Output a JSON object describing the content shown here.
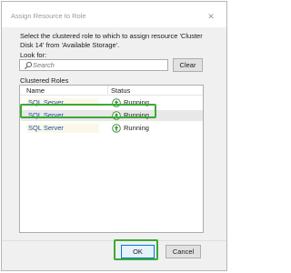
{
  "window": {
    "title": "Assign Resource to Role",
    "close_glyph": "✕"
  },
  "instruction": "Select the clustered role to which to assign resource 'Cluster Disk 14' from 'Available Storage'.",
  "look_for": {
    "label": "Look for:",
    "placeholder": "Search",
    "value": ""
  },
  "clear_button": "Clear",
  "clustered_roles": {
    "label": "Clustered Roles",
    "columns": [
      "Name",
      "Status"
    ],
    "rows": [
      {
        "name": "SQL Server",
        "status": "Running"
      },
      {
        "name": "SQL Server",
        "status": "Running"
      },
      {
        "name": "SQL Server",
        "status": "Running"
      }
    ]
  },
  "buttons": {
    "ok": "OK",
    "cancel": "Cancel"
  },
  "colors": {
    "highlight": "#3aaa35",
    "status_icon": "#3f8f3a",
    "link_text": "#1a4c9c"
  },
  "icons": {
    "search": "search-icon",
    "status": "running-status-icon"
  }
}
